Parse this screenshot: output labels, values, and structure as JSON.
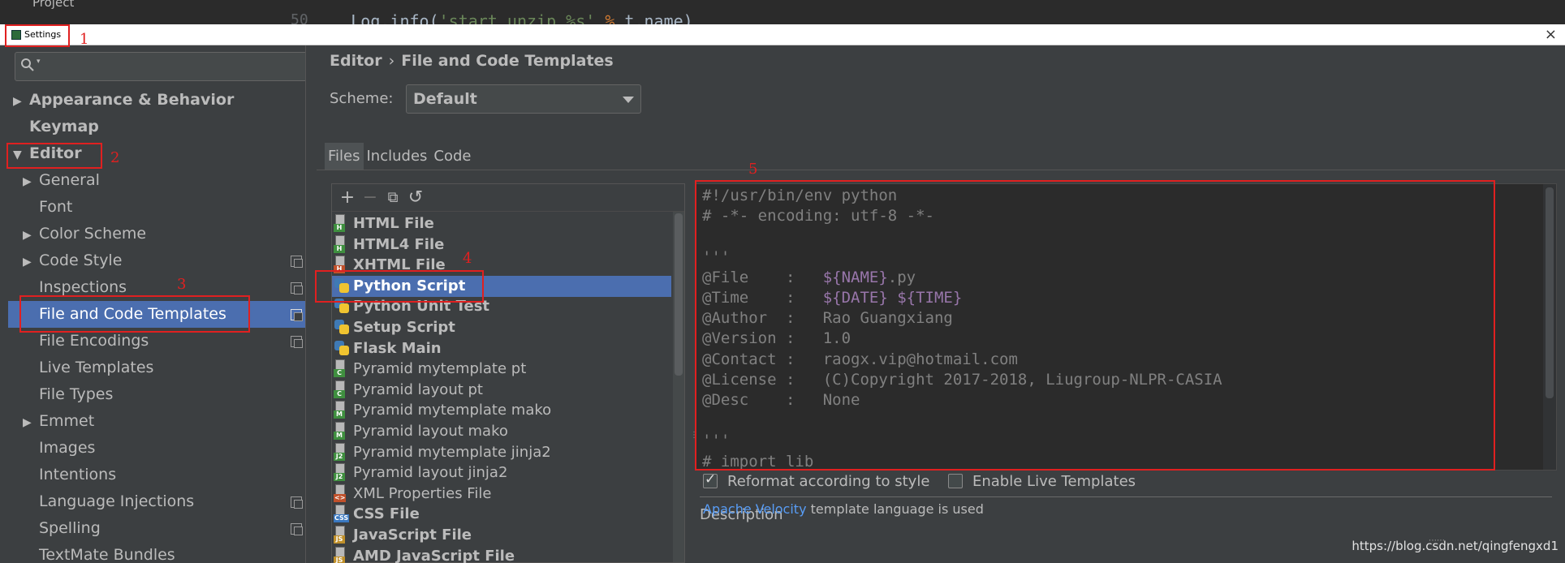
{
  "ide": {
    "project_label": "Project",
    "line_number": "50",
    "code_line_prefix": "Log.info(",
    "code_line_string": "'start unzip %s'",
    "code_line_op": " % ",
    "code_line_suffix": "t.name)"
  },
  "window": {
    "title": "Settings",
    "close": "×"
  },
  "annotations": {
    "n1": "1",
    "n2": "2",
    "n3": "3",
    "n4": "4",
    "n5": "5"
  },
  "sidebar": {
    "search_placeholder": "",
    "items": [
      {
        "label": "Appearance & Behavior",
        "arrow": "▶"
      },
      {
        "label": "Keymap",
        "arrow": ""
      },
      {
        "label": "Editor",
        "arrow": "▼"
      },
      {
        "label": "General",
        "arrow": "▶"
      },
      {
        "label": "Font",
        "arrow": ""
      },
      {
        "label": "Color Scheme",
        "arrow": "▶"
      },
      {
        "label": "Code Style",
        "arrow": "▶"
      },
      {
        "label": "Inspections",
        "arrow": ""
      },
      {
        "label": "File and Code Templates",
        "arrow": ""
      },
      {
        "label": "File Encodings",
        "arrow": ""
      },
      {
        "label": "Live Templates",
        "arrow": ""
      },
      {
        "label": "File Types",
        "arrow": ""
      },
      {
        "label": "Emmet",
        "arrow": "▶"
      },
      {
        "label": "Images",
        "arrow": ""
      },
      {
        "label": "Intentions",
        "arrow": ""
      },
      {
        "label": "Language Injections",
        "arrow": ""
      },
      {
        "label": "Spelling",
        "arrow": ""
      },
      {
        "label": "TextMate Bundles",
        "arrow": ""
      }
    ]
  },
  "main": {
    "breadcrumb_parent": "Editor",
    "breadcrumb_sep": "›",
    "breadcrumb_current": "File and Code Templates",
    "scheme_label": "Scheme:",
    "scheme_value": "Default",
    "tabs": [
      "Files",
      "Includes",
      "Code"
    ],
    "toolbar": {
      "add": "+",
      "remove": "−",
      "copy": "⧉",
      "reset": "↺"
    },
    "templates": [
      {
        "label": "HTML File",
        "tag": "H",
        "tag_color": "#3f8f3f"
      },
      {
        "label": "HTML4 File",
        "tag": "H",
        "tag_color": "#3f8f3f"
      },
      {
        "label": "XHTML File",
        "tag": "H",
        "tag_color": "#c0502a"
      },
      {
        "label": "Python Script",
        "tag": "py",
        "tag_color": "#3f7ab5"
      },
      {
        "label": "Python Unit Test",
        "tag": "py",
        "tag_color": "#3f7ab5"
      },
      {
        "label": "Setup Script",
        "tag": "py",
        "tag_color": "#3f7ab5"
      },
      {
        "label": "Flask Main",
        "tag": "py",
        "tag_color": "#3f7ab5"
      },
      {
        "label": "Pyramid mytemplate pt",
        "tag": "C",
        "tag_color": "#3f8f3f"
      },
      {
        "label": "Pyramid layout pt",
        "tag": "C",
        "tag_color": "#3f8f3f"
      },
      {
        "label": "Pyramid mytemplate mako",
        "tag": "M",
        "tag_color": "#3f8f3f"
      },
      {
        "label": "Pyramid layout mako",
        "tag": "M",
        "tag_color": "#3f8f3f"
      },
      {
        "label": "Pyramid mytemplate jinja2",
        "tag": "J2",
        "tag_color": "#3f8f3f"
      },
      {
        "label": "Pyramid layout jinja2",
        "tag": "J2",
        "tag_color": "#3f8f3f"
      },
      {
        "label": "XML Properties File",
        "tag": "<>",
        "tag_color": "#c0502a"
      },
      {
        "label": "CSS File",
        "tag": "CSS",
        "tag_color": "#3a78c0"
      },
      {
        "label": "JavaScript File",
        "tag": "JS",
        "tag_color": "#c0902a"
      },
      {
        "label": "AMD JavaScript File",
        "tag": "JS",
        "tag_color": "#c0902a"
      }
    ],
    "editor_lines": [
      {
        "pre": "#!/usr/bin/env python",
        "var": "",
        "post": ""
      },
      {
        "pre": "# -*- encoding: utf-8 -*-",
        "var": "",
        "post": ""
      },
      {
        "pre": "",
        "var": "",
        "post": ""
      },
      {
        "pre": "'''",
        "var": "",
        "post": ""
      },
      {
        "pre": "@File    :   ",
        "var": "${NAME}",
        "post": ".py"
      },
      {
        "pre": "@Time    :   ",
        "var": "${DATE} ${TIME}",
        "post": ""
      },
      {
        "pre": "@Author  :   Rao Guangxiang",
        "var": "",
        "post": ""
      },
      {
        "pre": "@Version :   1.0",
        "var": "",
        "post": ""
      },
      {
        "pre": "@Contact :   raogx.vip@hotmail.com",
        "var": "",
        "post": ""
      },
      {
        "pre": "@License :   (C)Copyright 2017-2018, Liugroup-NLPR-CASIA",
        "var": "",
        "post": ""
      },
      {
        "pre": "@Desc    :   None",
        "var": "",
        "post": ""
      },
      {
        "pre": "",
        "var": "",
        "post": ""
      },
      {
        "pre": "'''",
        "var": "",
        "post": ""
      },
      {
        "pre": "# import lib",
        "var": "",
        "post": ""
      }
    ],
    "reformat_label": "Reformat according to style",
    "reformat_checked": true,
    "live_templates_label": "Enable Live Templates",
    "live_templates_checked": false,
    "description_label": "Description",
    "description_link": "Apache Velocity",
    "description_text": " template language is used",
    "watermark": "https://blog.csdn.net/qingfengxd1"
  }
}
